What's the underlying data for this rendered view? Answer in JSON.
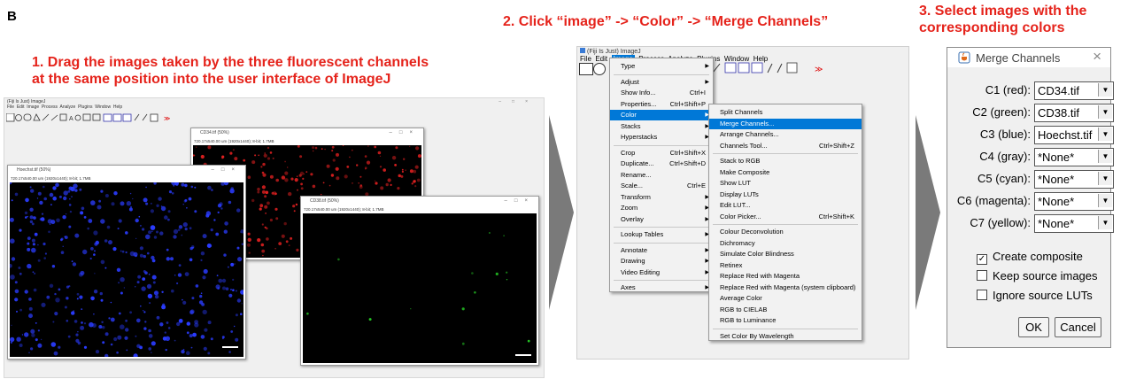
{
  "panel_letter": "B",
  "steps": {
    "step1": [
      "1. Drag the images taken by the three fluorescent channels",
      "at the same position into the user interface of ImageJ"
    ],
    "step2": "2. Click “image” -> “Color” -> “Merge Channels”",
    "step3": [
      "3. Select images with the",
      "corresponding colors"
    ]
  },
  "fiji": {
    "title": "(Fiji Is Just) ImageJ",
    "menubar": [
      "File",
      "Edit",
      "Image",
      "Process",
      "Analyze",
      "Plugins",
      "Window",
      "Help"
    ]
  },
  "image_windows": {
    "w_red": {
      "title": "CD34.tif (50%)",
      "info": "720.17x540.00 um (1920x1440); 8-bit; 1.7MB"
    },
    "w_blue": {
      "title": "Hoechst.tif (50%)",
      "info": "720.17x540.00 um (1920x1440); 8-bit; 1.7MB"
    },
    "w_green": {
      "title": "CD38.tif (50%)",
      "info": "720.17x540.00 um (1920x1440); 8-bit; 1.7MB"
    }
  },
  "image_menu": [
    {
      "label": "Type",
      "sub": true
    },
    {
      "sep": true
    },
    {
      "label": "Adjust",
      "sub": true
    },
    {
      "label": "Show Info...",
      "shortcut": "Ctrl+I"
    },
    {
      "label": "Properties...",
      "shortcut": "Ctrl+Shift+P"
    },
    {
      "label": "Color",
      "sub": true,
      "hl": true
    },
    {
      "label": "Stacks",
      "sub": true
    },
    {
      "label": "Hyperstacks",
      "sub": true
    },
    {
      "sep": true
    },
    {
      "label": "Crop",
      "shortcut": "Ctrl+Shift+X"
    },
    {
      "label": "Duplicate...",
      "shortcut": "Ctrl+Shift+D"
    },
    {
      "label": "Rename..."
    },
    {
      "label": "Scale...",
      "shortcut": "Ctrl+E"
    },
    {
      "label": "Transform",
      "sub": true
    },
    {
      "label": "Zoom",
      "sub": true
    },
    {
      "label": "Overlay",
      "sub": true
    },
    {
      "sep": true
    },
    {
      "label": "Lookup Tables",
      "sub": true
    },
    {
      "sep": true
    },
    {
      "label": "Annotate",
      "sub": true
    },
    {
      "label": "Drawing",
      "sub": true
    },
    {
      "label": "Video Editing",
      "sub": true
    },
    {
      "sep": true
    },
    {
      "label": "Axes",
      "sub": true
    }
  ],
  "color_menu": [
    {
      "label": "Split Channels"
    },
    {
      "label": "Merge Channels...",
      "hl": true
    },
    {
      "label": "Arrange Channels..."
    },
    {
      "label": "Channels Tool...",
      "shortcut": "Ctrl+Shift+Z"
    },
    {
      "sep": true
    },
    {
      "label": "Stack to RGB"
    },
    {
      "label": "Make Composite"
    },
    {
      "label": "Show LUT"
    },
    {
      "label": "Display LUTs"
    },
    {
      "label": "Edit LUT..."
    },
    {
      "label": "Color Picker...",
      "shortcut": "Ctrl+Shift+K"
    },
    {
      "sep": true
    },
    {
      "label": "Colour Deconvolution"
    },
    {
      "label": "Dichromacy"
    },
    {
      "label": "Simulate Color Blindness"
    },
    {
      "label": "Retinex"
    },
    {
      "label": "Replace Red with Magenta"
    },
    {
      "label": "Replace Red with Magenta (system clipboard)"
    },
    {
      "label": "Average Color"
    },
    {
      "label": "RGB to CIELAB"
    },
    {
      "label": "RGB to Luminance"
    },
    {
      "sep": true
    },
    {
      "label": "Set Color By Wavelength"
    }
  ],
  "merge_dialog": {
    "title": "Merge Channels",
    "close": "×",
    "channels": [
      {
        "label": "C1 (red):",
        "value": "CD34.tif"
      },
      {
        "label": "C2 (green):",
        "value": "CD38.tif"
      },
      {
        "label": "C3 (blue):",
        "value": "Hoechst.tif"
      },
      {
        "label": "C4 (gray):",
        "value": "*None*"
      },
      {
        "label": "C5 (cyan):",
        "value": "*None*"
      },
      {
        "label": "C6 (magenta):",
        "value": "*None*"
      },
      {
        "label": "C7 (yellow):",
        "value": "*None*"
      }
    ],
    "options": [
      {
        "label": "Create composite",
        "checked": true
      },
      {
        "label": "Keep source images",
        "checked": false
      },
      {
        "label": "Ignore source LUTs",
        "checked": false
      }
    ],
    "ok": "OK",
    "cancel": "Cancel"
  },
  "colors": {
    "accent": "#0078d7",
    "step_text": "#e5231b",
    "arrow": "#7a7a7a"
  }
}
